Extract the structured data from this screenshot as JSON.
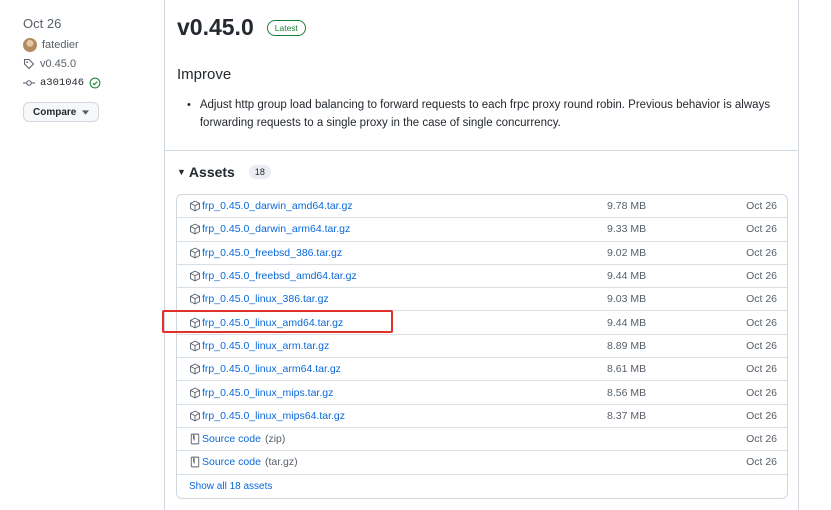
{
  "meta": {
    "date": "Oct 26",
    "author": "fatedier",
    "tag": "v0.45.0",
    "commit": "a301046",
    "compare_label": "Compare"
  },
  "release": {
    "title": "v0.45.0",
    "badge": "Latest",
    "section_heading": "Improve",
    "bullet": "Adjust http group load balancing to forward requests to each frpc proxy round robin. Previous behavior is always forwarding requests to a single proxy in the case of single concurrency."
  },
  "assets": {
    "heading": "Assets",
    "count": "18",
    "rows": [
      {
        "name": "frp_0.45.0_darwin_amd64.tar.gz",
        "size": "9.78 MB",
        "date": "Oct 26"
      },
      {
        "name": "frp_0.45.0_darwin_arm64.tar.gz",
        "size": "9.33 MB",
        "date": "Oct 26"
      },
      {
        "name": "frp_0.45.0_freebsd_386.tar.gz",
        "size": "9.02 MB",
        "date": "Oct 26"
      },
      {
        "name": "frp_0.45.0_freebsd_amd64.tar.gz",
        "size": "9.44 MB",
        "date": "Oct 26"
      },
      {
        "name": "frp_0.45.0_linux_386.tar.gz",
        "size": "9.03 MB",
        "date": "Oct 26"
      },
      {
        "name": "frp_0.45.0_linux_amd64.tar.gz",
        "size": "9.44 MB",
        "date": "Oct 26"
      },
      {
        "name": "frp_0.45.0_linux_arm.tar.gz",
        "size": "8.89 MB",
        "date": "Oct 26"
      },
      {
        "name": "frp_0.45.0_linux_arm64.tar.gz",
        "size": "8.61 MB",
        "date": "Oct 26"
      },
      {
        "name": "frp_0.45.0_linux_mips.tar.gz",
        "size": "8.56 MB",
        "date": "Oct 26"
      },
      {
        "name": "frp_0.45.0_linux_mips64.tar.gz",
        "size": "8.37 MB",
        "date": "Oct 26"
      }
    ],
    "source": [
      {
        "label": "Source code",
        "ext": "(zip)",
        "date": "Oct 26"
      },
      {
        "label": "Source code",
        "ext": "(tar.gz)",
        "date": "Oct 26"
      }
    ],
    "show_all": "Show all 18 assets"
  },
  "colors": {
    "link": "#0969da",
    "latest": "#1a7f37",
    "highlight": "#e0322b"
  }
}
